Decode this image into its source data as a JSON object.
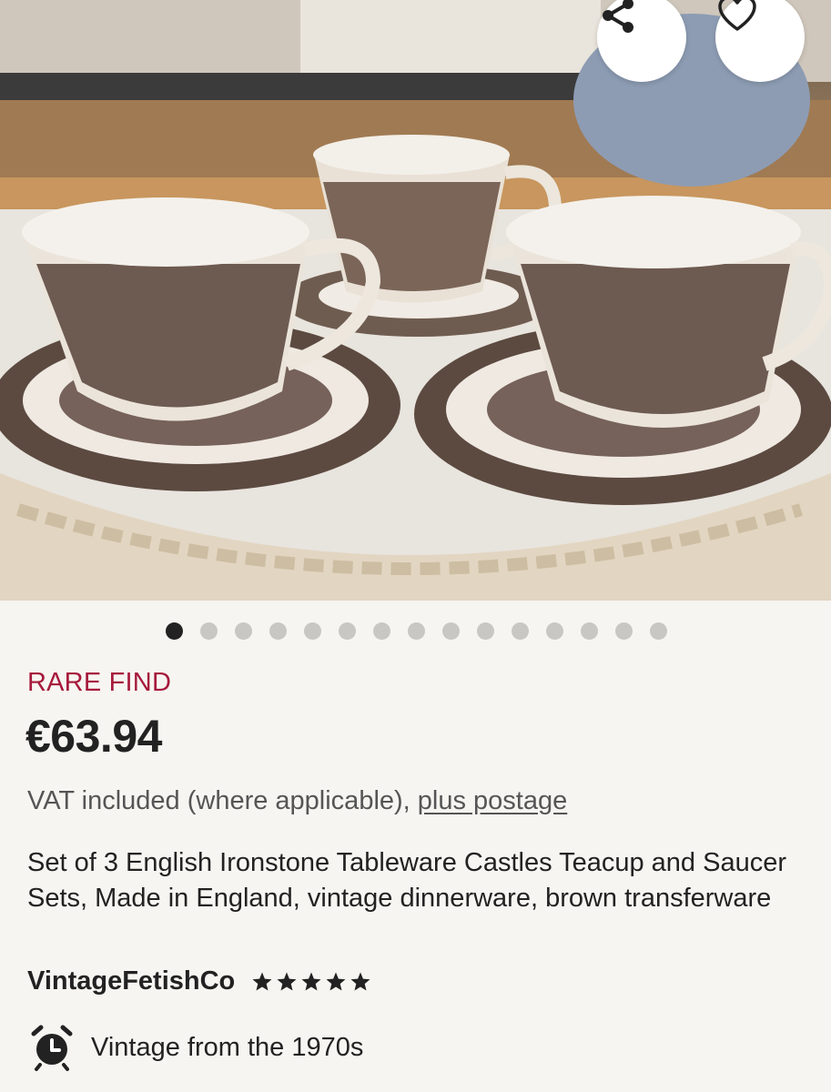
{
  "photo": {
    "alt_subject": "teacup-and-saucer-photo",
    "carousel": {
      "total": 15,
      "active_index": 0
    }
  },
  "actions": {
    "share_icon": "share-icon",
    "favorite_icon": "heart-icon"
  },
  "listing": {
    "badge": "RARE FIND",
    "price": "€63.94",
    "vat_prefix": "VAT included (where applicable), ",
    "vat_link": "plus postage",
    "title": "Set of 3 English Ironstone Tableware Castles Teacup and Saucer Sets, Made in England, vintage dinnerware, brown transferware",
    "shop_name": "VintageFetishCo",
    "rating": 5,
    "rating_icon": "star-icon",
    "vintage_icon": "alarm-clock-icon",
    "vintage_text": "Vintage from the 1970s"
  },
  "colors": {
    "badge": "#a61a3c",
    "text": "#222222",
    "muted": "#555555",
    "background": "#f7f5f1",
    "dot_active": "#222222",
    "dot_inactive": "#c9c7c3"
  }
}
